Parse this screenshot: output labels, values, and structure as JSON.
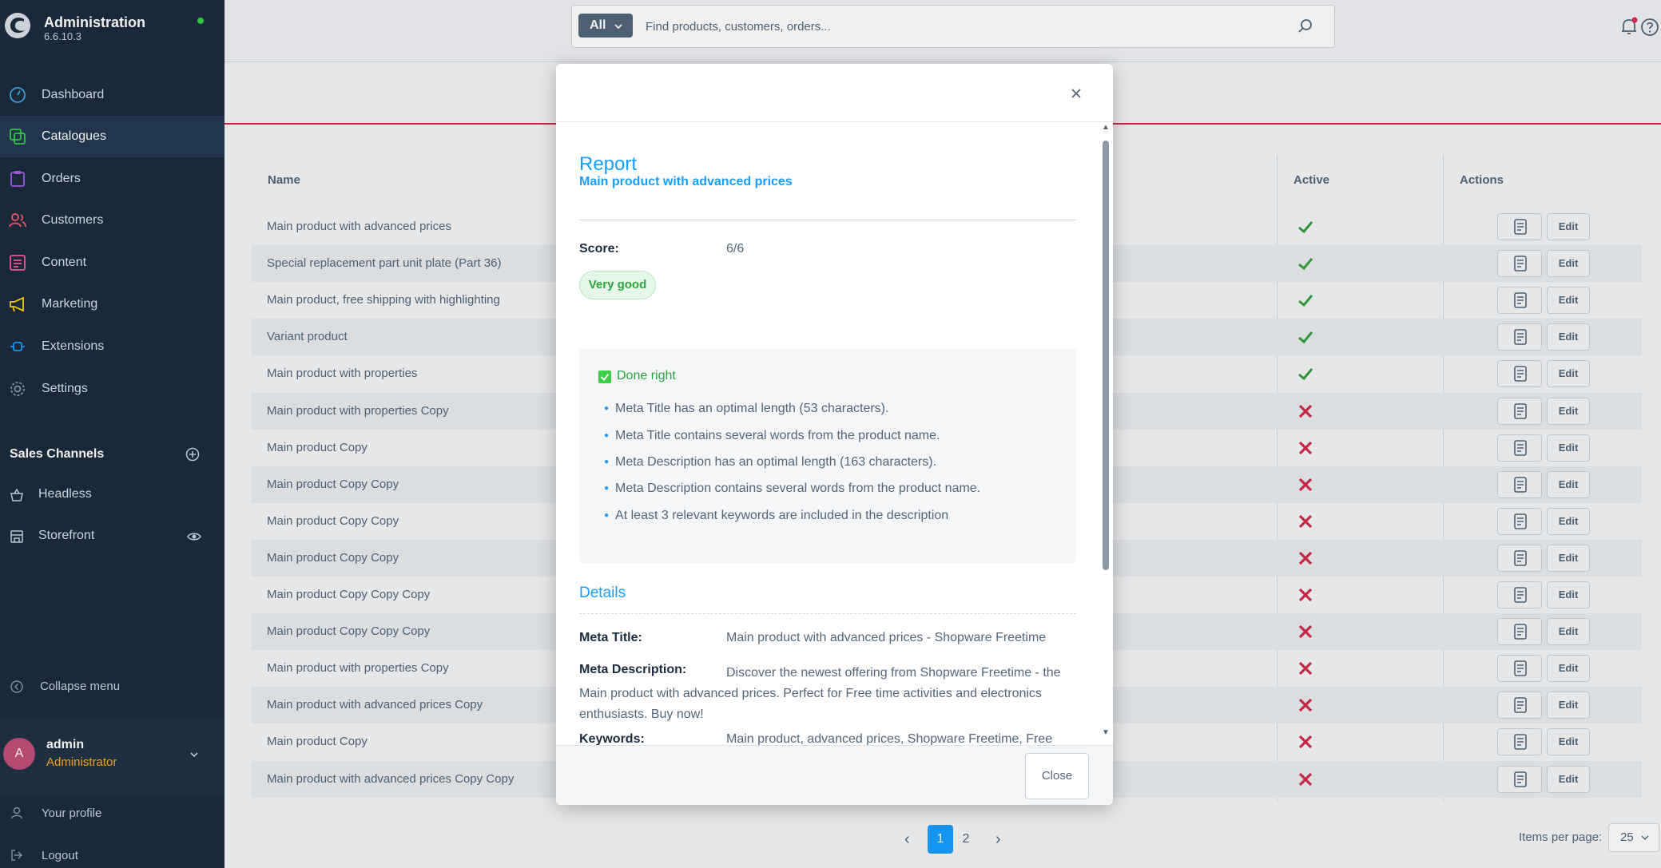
{
  "app": {
    "title": "Administration",
    "version": "6.6.10.3"
  },
  "sidebar": {
    "items": [
      {
        "label": "Dashboard",
        "icon": "gauge-icon"
      },
      {
        "label": "Catalogues",
        "icon": "catalogue-icon"
      },
      {
        "label": "Orders",
        "icon": "clipboard-icon"
      },
      {
        "label": "Customers",
        "icon": "users-icon"
      },
      {
        "label": "Content",
        "icon": "content-icon"
      },
      {
        "label": "Marketing",
        "icon": "megaphone-icon"
      },
      {
        "label": "Extensions",
        "icon": "plug-icon"
      },
      {
        "label": "Settings",
        "icon": "gear-icon"
      }
    ],
    "sales_channels_title": "Sales Channels",
    "sales_channels": [
      {
        "label": "Headless",
        "icon": "basket-icon"
      },
      {
        "label": "Storefront",
        "icon": "storefront-icon"
      }
    ],
    "collapse_label": "Collapse menu",
    "user": {
      "initial": "A",
      "name": "admin",
      "role": "Administrator"
    },
    "profile_label": "Your profile",
    "logout_label": "Logout"
  },
  "search": {
    "type": "All",
    "placeholder": "Find products, customers, orders..."
  },
  "table": {
    "headers": {
      "name": "Name",
      "active": "Active",
      "actions": "Actions"
    },
    "edit_label": "Edit",
    "rows": [
      {
        "name": "Main product with advanced prices",
        "active": true
      },
      {
        "name": "Special replacement part unit plate (Part 36)",
        "active": true
      },
      {
        "name": "Main product, free shipping with highlighting",
        "active": true
      },
      {
        "name": "Variant product",
        "active": true
      },
      {
        "name": "Main product with properties",
        "active": true
      },
      {
        "name": "Main product with properties Copy",
        "active": false
      },
      {
        "name": "Main product Copy",
        "active": false
      },
      {
        "name": "Main product Copy Copy",
        "active": false
      },
      {
        "name": "Main product Copy Copy",
        "active": false
      },
      {
        "name": "Main product Copy Copy",
        "active": false
      },
      {
        "name": "Main product Copy Copy Copy",
        "active": false
      },
      {
        "name": "Main product Copy Copy Copy",
        "active": false
      },
      {
        "name": "Main product with properties Copy",
        "active": false
      },
      {
        "name": "Main product with advanced prices Copy",
        "active": false
      },
      {
        "name": "Main product Copy",
        "active": false
      },
      {
        "name": "Main product with advanced prices Copy Copy",
        "active": false
      }
    ]
  },
  "pagination": {
    "prev": "‹",
    "next": "›",
    "pages": [
      "1",
      "2"
    ],
    "current": "1",
    "items_per_page_label": "Items per page:",
    "items_per_page": "25"
  },
  "modal": {
    "title": "Report",
    "subtitle": "Main product with advanced prices",
    "score_label": "Score:",
    "score_value": "6/6",
    "score_badge": "Very good",
    "done_title": "Done right",
    "done_items": [
      "Meta Title has an optimal length (53 characters).",
      "Meta Title contains several words from the product name.",
      "Meta Description has an optimal length (163 characters).",
      "Meta Description contains several words from the product name.",
      "At least 3 relevant keywords are included in the description"
    ],
    "details_title": "Details",
    "meta_title_label": "Meta Title:",
    "meta_title_value": "Main product with advanced prices - Shopware Freetime",
    "meta_desc_label": "Meta Description:",
    "meta_desc_value": "Discover the newest offering from Shopware Freetime - the Main product with advanced prices. Perfect for Free time activities and electronics enthusiasts. Buy now!",
    "keywords_label": "Keywords:",
    "keywords_value": "Main product, advanced prices, Shopware Freetime, Free",
    "close_label": "Close"
  },
  "colors": {
    "accent": "#189eff",
    "sidebar": "#1b2c3e",
    "success": "#37d046",
    "danger": "#de294c",
    "warning": "#ffab22"
  }
}
